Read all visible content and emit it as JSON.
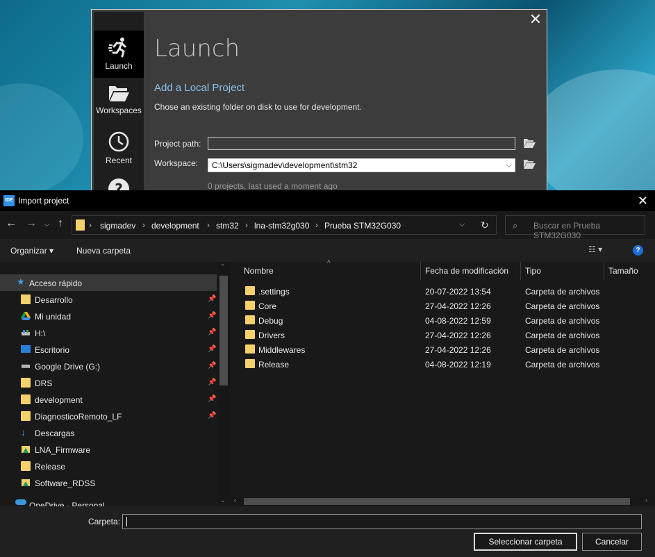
{
  "launch": {
    "nav": [
      {
        "label": "Launch",
        "icon": "runner-icon"
      },
      {
        "label": "Workspaces",
        "icon": "folder-open-icon"
      },
      {
        "label": "Recent",
        "icon": "clock-icon"
      }
    ],
    "title": "Launch",
    "subtitle": "Add a Local Project",
    "description": "Chose an existing folder on disk to use for development.",
    "project_path_label": "Project path:",
    "project_path_value": "",
    "workspace_label": "Workspace:",
    "workspace_value": "C:\\Users\\sigmadev\\development\\stm32",
    "status": "0 projects, last used a moment ago",
    "close": "✕"
  },
  "import": {
    "title": "Import project",
    "close": "✕",
    "breadcrumb": [
      "sigmadev",
      "development",
      "stm32",
      "lna-stm32g030",
      "Prueba STM32G030"
    ],
    "search_placeholder": "Buscar en Prueba STM32G030",
    "organize": "Organizar ▾",
    "new_folder": "Nueva carpeta",
    "help": "?",
    "nav_items": [
      {
        "label": "Acceso rápido",
        "icon": "star-icon",
        "pinned": false
      },
      {
        "label": "Desarrollo",
        "icon": "folder-icon",
        "pinned": true
      },
      {
        "label": "Mi unidad",
        "icon": "google-drive-icon",
        "pinned": true
      },
      {
        "label": "H:\\",
        "icon": "drive-icon",
        "pinned": true
      },
      {
        "label": "Escritorio",
        "icon": "desktop-icon",
        "pinned": true
      },
      {
        "label": "Google Drive (G:)",
        "icon": "drive-icon",
        "pinned": true
      },
      {
        "label": "DRS",
        "icon": "folder-icon",
        "pinned": true
      },
      {
        "label": "development",
        "icon": "folder-icon",
        "pinned": true
      },
      {
        "label": "DiagnosticoRemoto_LF",
        "icon": "folder-icon",
        "pinned": true
      },
      {
        "label": "Descargas",
        "icon": "download-icon",
        "pinned": false
      },
      {
        "label": "LNA_Firmware",
        "icon": "google-drive-icon",
        "pinned": false
      },
      {
        "label": "Release",
        "icon": "folder-icon",
        "pinned": false
      },
      {
        "label": "Software_RDSS",
        "icon": "google-drive-icon",
        "pinned": false
      },
      {
        "label": "OneDrive - Personal",
        "icon": "cloud-icon",
        "pinned": false
      }
    ],
    "columns": [
      "Nombre",
      "Fecha de modificación",
      "Tipo",
      "Tamaño"
    ],
    "files": [
      {
        "name": ".settings",
        "date": "20-07-2022 13:54",
        "type": "Carpeta de archivos"
      },
      {
        "name": "Core",
        "date": "27-04-2022 12:26",
        "type": "Carpeta de archivos"
      },
      {
        "name": "Debug",
        "date": "04-08-2022 12:59",
        "type": "Carpeta de archivos"
      },
      {
        "name": "Drivers",
        "date": "27-04-2022 12:26",
        "type": "Carpeta de archivos"
      },
      {
        "name": "Middlewares",
        "date": "27-04-2022 12:26",
        "type": "Carpeta de archivos"
      },
      {
        "name": "Release",
        "date": "04-08-2022 12:19",
        "type": "Carpeta de archivos"
      }
    ],
    "folder_label": "Carpeta:",
    "folder_value": "",
    "select_button": "Seleccionar carpeta",
    "cancel_button": "Cancelar"
  }
}
